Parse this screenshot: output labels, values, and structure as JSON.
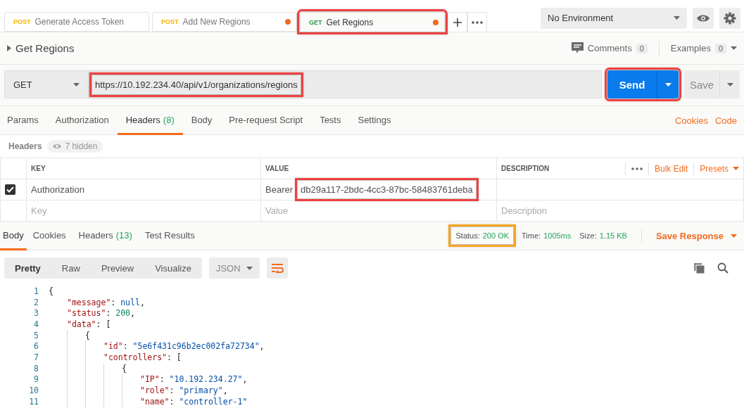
{
  "tabs": [
    {
      "method": "POST",
      "color": "#f4b400",
      "label": "Generate Access Token",
      "unsaved": false,
      "selected": false,
      "annotated": false
    },
    {
      "method": "POST",
      "color": "#f4b400",
      "label": "Add New Regions",
      "unsaved": true,
      "selected": false,
      "annotated": false
    },
    {
      "method": "GET",
      "color": "#2c9c4a",
      "label": "Get Regions",
      "unsaved": true,
      "selected": true,
      "annotated": true
    }
  ],
  "environment": {
    "value": "No Environment"
  },
  "request": {
    "title": "Get Regions",
    "comments_label": "Comments",
    "comments_count": "0",
    "examples_label": "Examples",
    "examples_count": "0",
    "method": "GET",
    "url": "https://10.192.234.40/api/v1/organizations/regions",
    "url_annotated": true,
    "send": "Send",
    "send_annotated": true,
    "save": "Save"
  },
  "request_tabs": [
    {
      "label": "Params",
      "selected": false
    },
    {
      "label": "Authorization",
      "selected": false
    },
    {
      "label": "Headers",
      "count": "(8)",
      "selected": true
    },
    {
      "label": "Body",
      "selected": false
    },
    {
      "label": "Pre-request Script",
      "selected": false
    },
    {
      "label": "Tests",
      "selected": false
    },
    {
      "label": "Settings",
      "selected": false
    }
  ],
  "request_links": [
    "Cookies",
    "Code"
  ],
  "headers": {
    "title": "Headers",
    "hidden": "7 hidden",
    "columns": [
      "KEY",
      "VALUE",
      "DESCRIPTION"
    ],
    "bulk_edit": "Bulk Edit",
    "presets": "Presets",
    "rows": [
      {
        "checked": true,
        "key": "Authorization",
        "value_prefix": "Bearer",
        "value": "db29a117-2bdc-4cc3-87bc-58483761deba",
        "value_annotated": true
      }
    ],
    "placeholders": {
      "key": "Key",
      "value": "Value",
      "description": "Description"
    }
  },
  "response_tabs": [
    {
      "label": "Body",
      "selected": true
    },
    {
      "label": "Cookies",
      "selected": false
    },
    {
      "label": "Headers",
      "count": "(13)",
      "selected": false
    },
    {
      "label": "Test Results",
      "selected": false
    }
  ],
  "response_meta": {
    "status_label": "Status:",
    "status": "200 OK",
    "status_annotated": true,
    "time_label": "Time:",
    "time": "1005ms",
    "size_label": "Size:",
    "size": "1.15 KB",
    "save_response": "Save Response"
  },
  "view_modes": [
    {
      "label": "Pretty",
      "selected": true
    },
    {
      "label": "Raw",
      "selected": false
    },
    {
      "label": "Preview",
      "selected": false
    },
    {
      "label": "Visualize",
      "selected": false
    }
  ],
  "format": "JSON",
  "code": [
    {
      "n": "1",
      "tokens": [
        {
          "kind": "punct",
          "text": "{"
        }
      ],
      "children": [
        {
          "n": "2",
          "tokens": [
            {
              "kind": "key",
              "text": "\"message\""
            },
            {
              "kind": "punct",
              "text": ": "
            },
            {
              "kind": "literal",
              "text": "null"
            },
            {
              "kind": "punct",
              "text": ","
            }
          ]
        },
        {
          "n": "3",
          "tokens": [
            {
              "kind": "key",
              "text": "\"status\""
            },
            {
              "kind": "punct",
              "text": ": "
            },
            {
              "kind": "number",
              "text": "200"
            },
            {
              "kind": "punct",
              "text": ","
            }
          ]
        },
        {
          "n": "4",
          "tokens": [
            {
              "kind": "key",
              "text": "\"data\""
            },
            {
              "kind": "punct",
              "text": ": ["
            }
          ],
          "children": [
            {
              "n": "5",
              "tokens": [
                {
                  "kind": "punct",
                  "text": "{"
                }
              ],
              "children": [
                {
                  "n": "6",
                  "tokens": [
                    {
                      "kind": "key",
                      "text": "\"id\""
                    },
                    {
                      "kind": "punct",
                      "text": ": "
                    },
                    {
                      "kind": "string",
                      "text": "\"5e6f431c96b2ec002fa72734\""
                    },
                    {
                      "kind": "punct",
                      "text": ","
                    }
                  ]
                },
                {
                  "n": "7",
                  "tokens": [
                    {
                      "kind": "key",
                      "text": "\"controllers\""
                    },
                    {
                      "kind": "punct",
                      "text": ": ["
                    }
                  ],
                  "children": [
                    {
                      "n": "8",
                      "tokens": [
                        {
                          "kind": "punct",
                          "text": "{"
                        }
                      ],
                      "children": [
                        {
                          "n": "9",
                          "tokens": [
                            {
                              "kind": "key",
                              "text": "\"IP\""
                            },
                            {
                              "kind": "punct",
                              "text": ": "
                            },
                            {
                              "kind": "string",
                              "text": "\"10.192.234.27\""
                            },
                            {
                              "kind": "punct",
                              "text": ","
                            }
                          ]
                        },
                        {
                          "n": "10",
                          "tokens": [
                            {
                              "kind": "key",
                              "text": "\"role\""
                            },
                            {
                              "kind": "punct",
                              "text": ": "
                            },
                            {
                              "kind": "string",
                              "text": "\"primary\""
                            },
                            {
                              "kind": "punct",
                              "text": ","
                            }
                          ]
                        },
                        {
                          "n": "11",
                          "tokens": [
                            {
                              "kind": "key",
                              "text": "\"name\""
                            },
                            {
                              "kind": "punct",
                              "text": ": "
                            },
                            {
                              "kind": "string",
                              "text": "\"controller-1\""
                            }
                          ]
                        }
                      ]
                    }
                  ]
                }
              ]
            }
          ]
        }
      ]
    }
  ]
}
